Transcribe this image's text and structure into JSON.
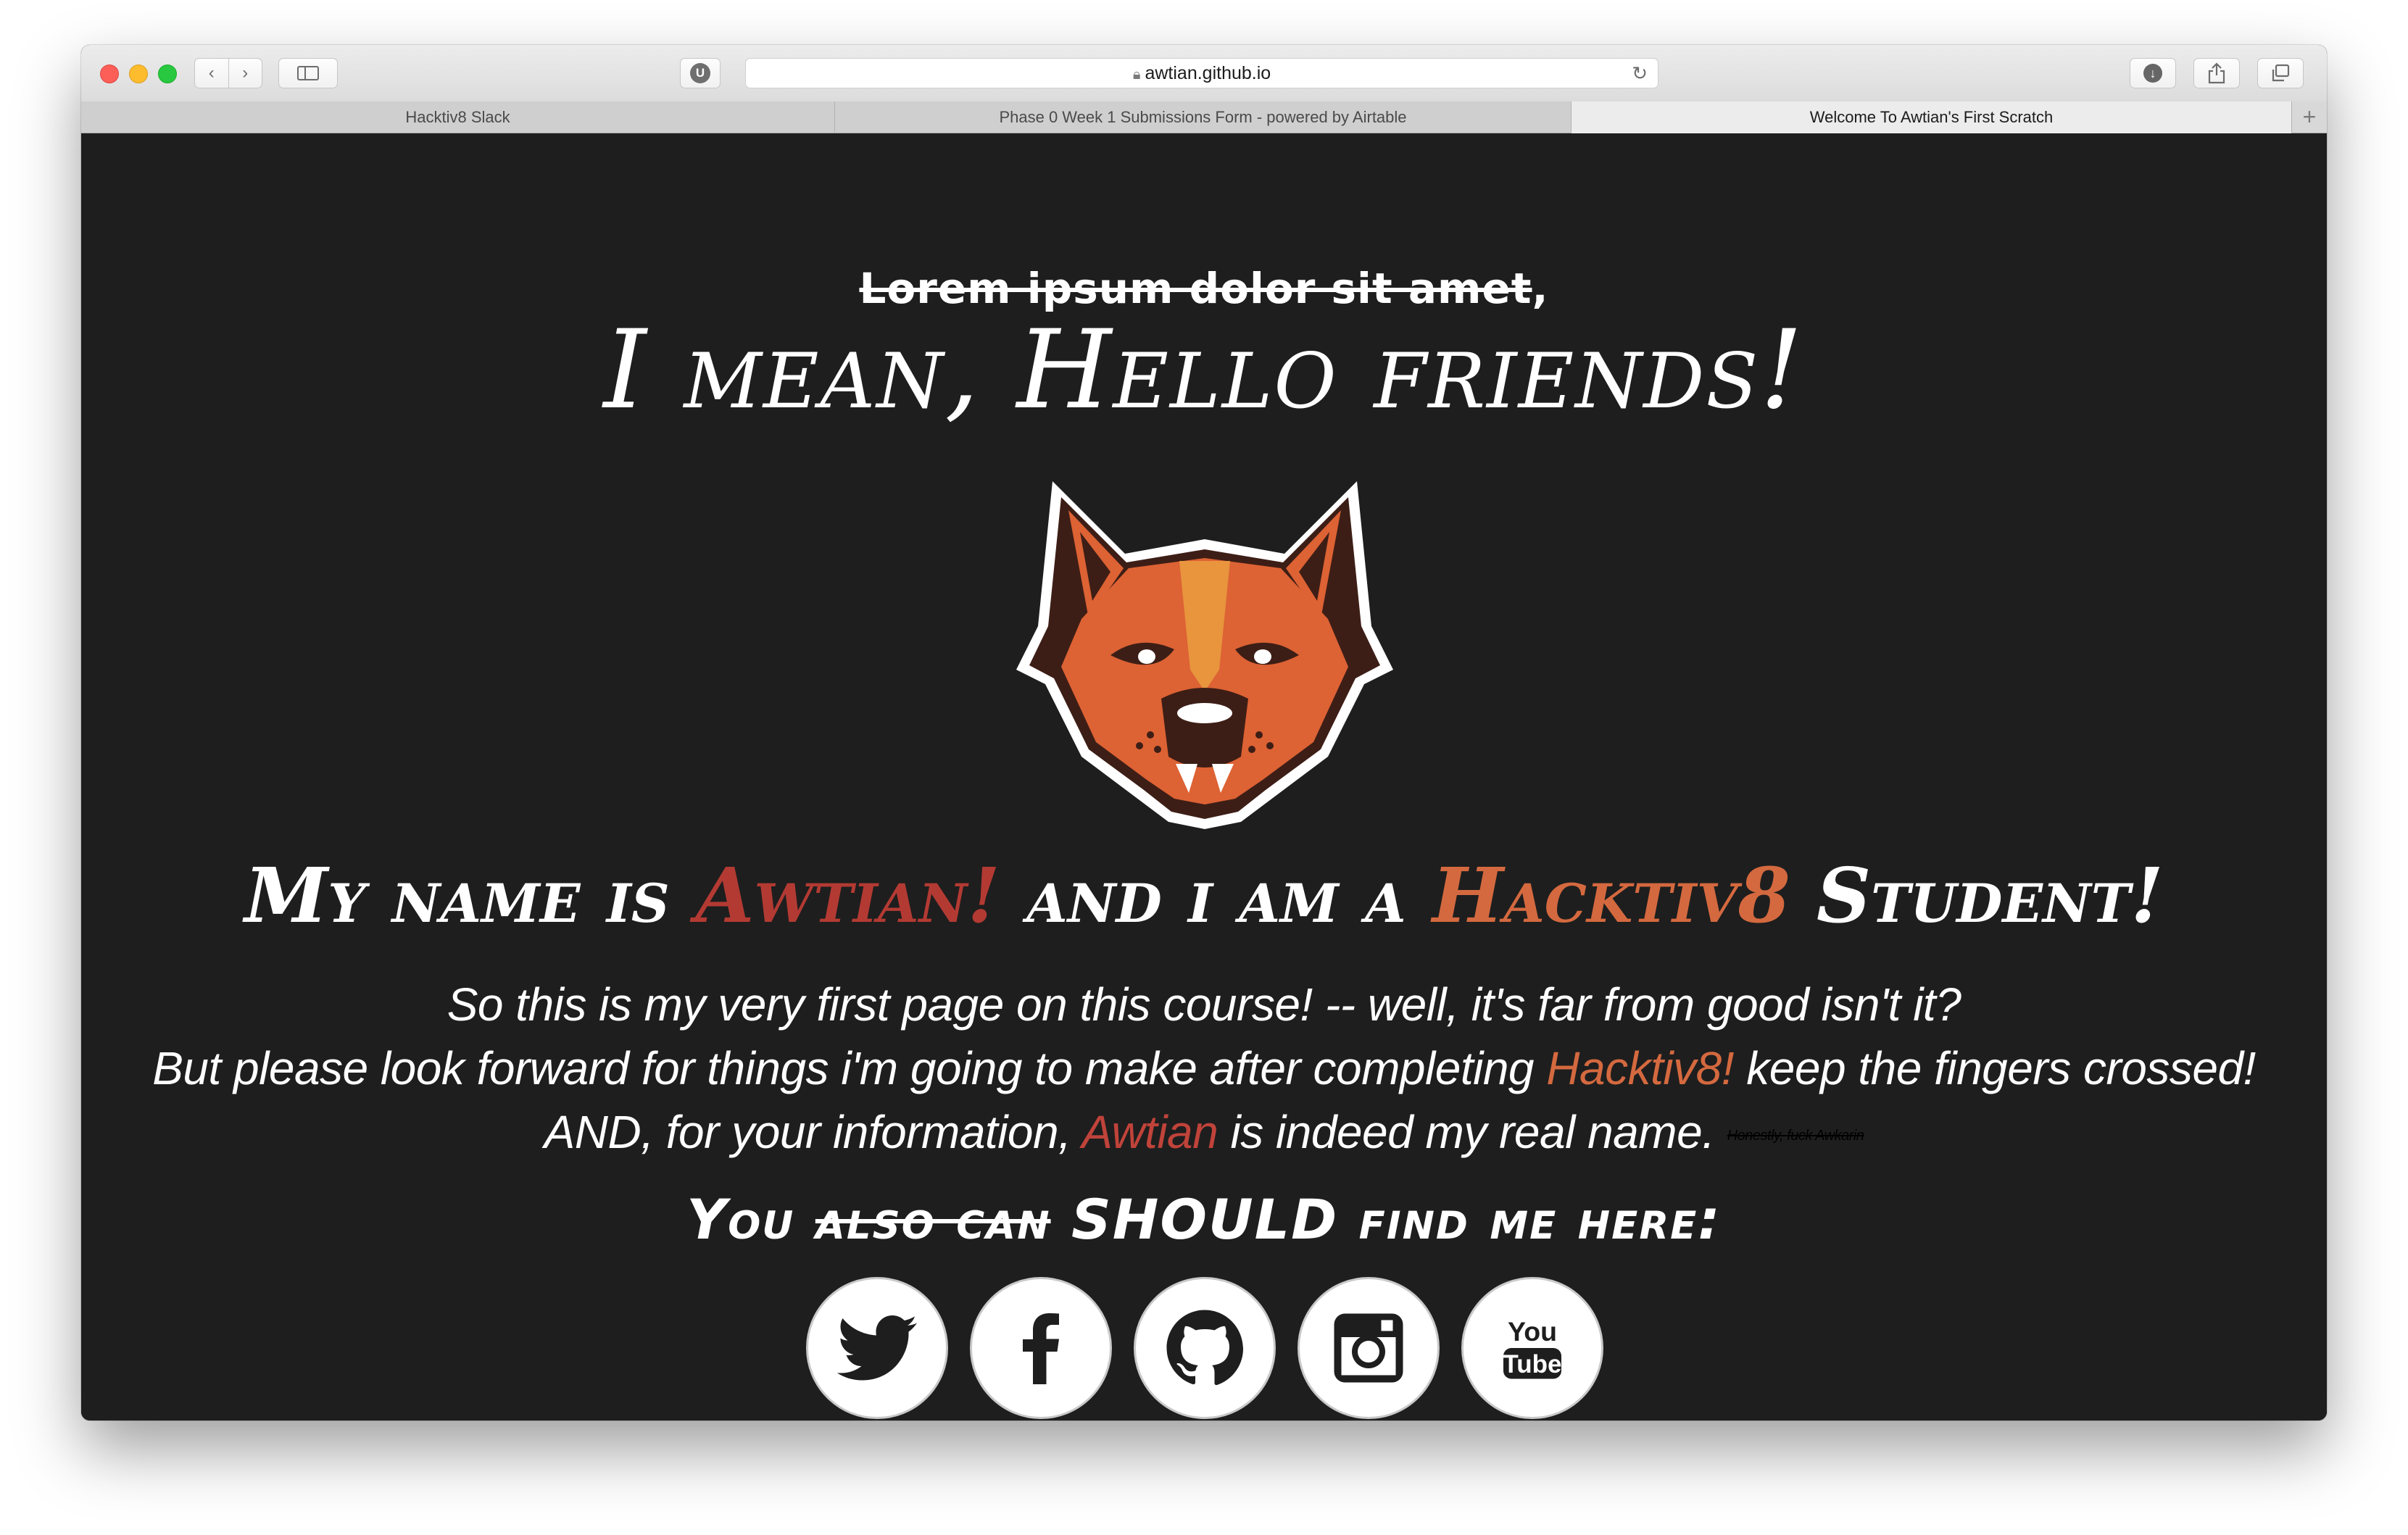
{
  "browser": {
    "url": "awtian.github.io",
    "tabs": [
      {
        "label": "Hacktiv8 Slack",
        "active": false
      },
      {
        "label": "Phase 0 Week 1 Submissions Form - powered by Airtable",
        "active": false
      },
      {
        "label": "Welcome To Awtian's First Scratch",
        "active": true
      }
    ],
    "extension_letter": "U",
    "new_tab_symbol": "+"
  },
  "page": {
    "lorem_struck": "Lorem ipsum dolor sit amet",
    "lorem_tail": ",",
    "headline": "I mean, Hello friends!",
    "intro": {
      "part1": "My name is ",
      "name": "Awtian!",
      "part2": " and i am a ",
      "school": "Hacktiv8",
      "part3": " Student!"
    },
    "paragraph": {
      "line1": "So this is my very first page on this course! -- well, it's far from good isn't it?",
      "line2_a": "But please look forward for things i'm going to make after completing ",
      "line2_hack": "Hacktiv8!",
      "line2_b": " keep the fingers crossed!",
      "line3_a": "AND, for your information, ",
      "line3_name": "Awtian",
      "line3_b": " is indeed my real name.",
      "footnote": "Honestly, fuck Awkarin"
    },
    "find": {
      "part1": "You ",
      "struck": "also can",
      "part2": " SHOULD find me here:"
    },
    "socials": [
      {
        "name": "twitter",
        "icon": "twitter-icon"
      },
      {
        "name": "facebook",
        "icon": "facebook-icon"
      },
      {
        "name": "github",
        "icon": "github-icon"
      },
      {
        "name": "instagram",
        "icon": "instagram-icon"
      },
      {
        "name": "youtube",
        "icon": "youtube-icon",
        "text_top": "You",
        "text_bottom": "Tube"
      }
    ],
    "colors": {
      "background": "#1e1e1e",
      "name_red": "#b33a33",
      "accent_orange": "#d4693f",
      "fox_orange": "#dd6234",
      "fox_dark": "#3d1e16"
    }
  }
}
